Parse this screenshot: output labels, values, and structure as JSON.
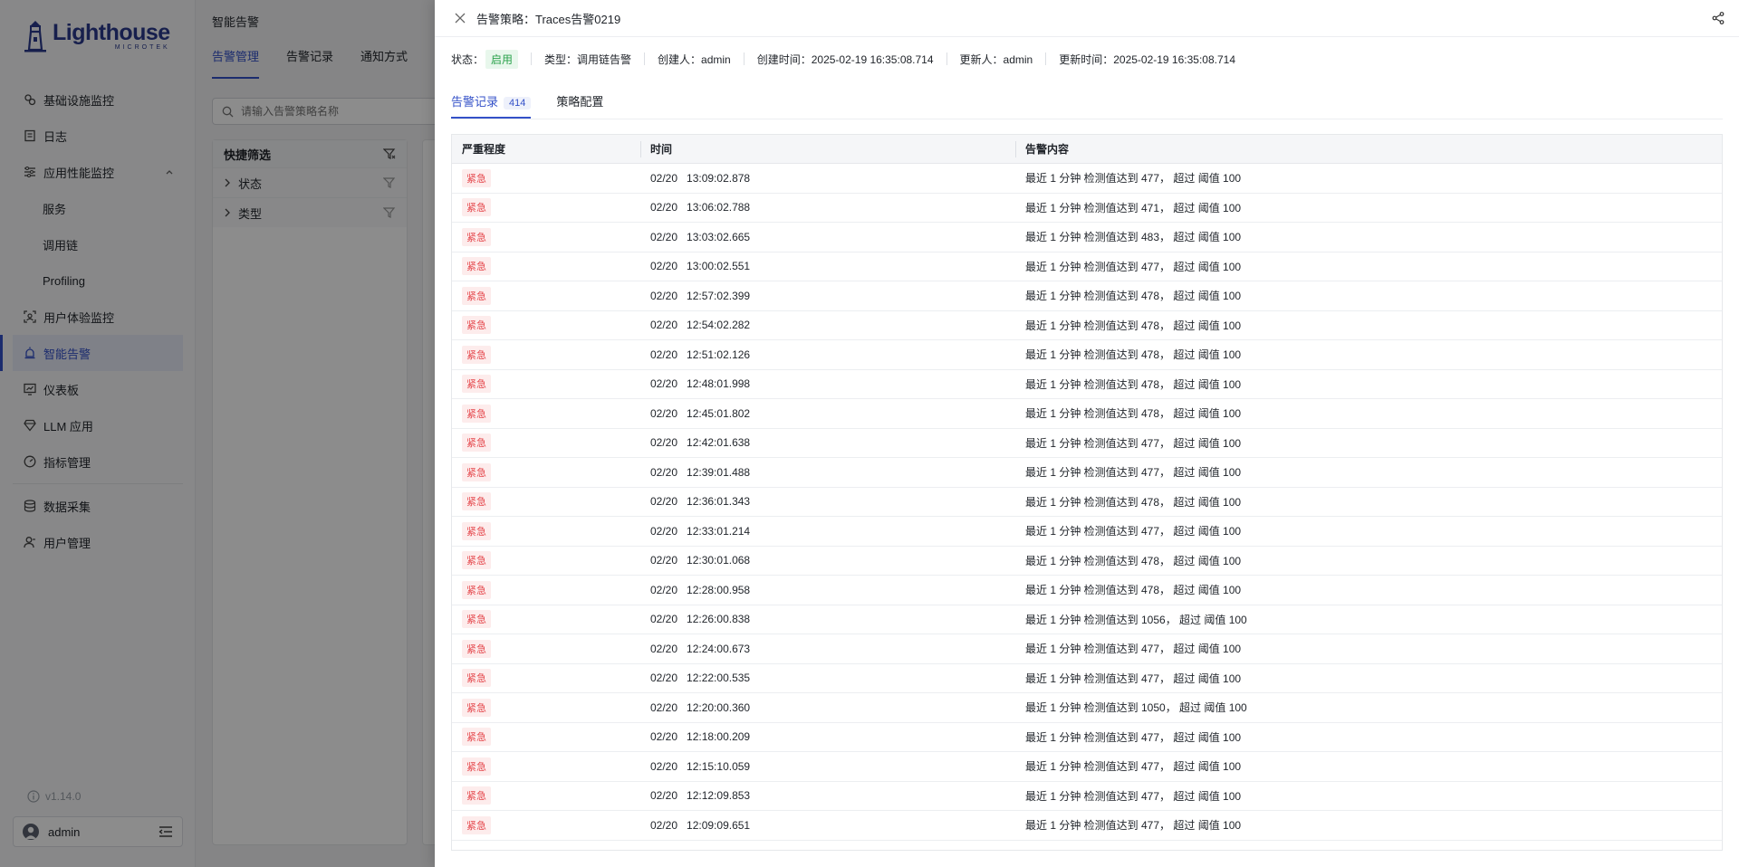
{
  "brand": {
    "name": "Lighthouse",
    "sub": "MICROTEK"
  },
  "sidebar": {
    "items": [
      {
        "label": "基础设施监控",
        "icon": "infra-icon"
      },
      {
        "label": "日志",
        "icon": "log-icon"
      },
      {
        "label": "应用性能监控",
        "icon": "apm-icon",
        "expanded": true,
        "children": [
          {
            "label": "服务"
          },
          {
            "label": "调用链"
          },
          {
            "label": "Profiling"
          }
        ]
      },
      {
        "label": "用户体验监控",
        "icon": "rum-icon"
      },
      {
        "label": "智能告警",
        "icon": "alert-icon",
        "active": true
      },
      {
        "label": "仪表板",
        "icon": "dashboard-icon"
      },
      {
        "label": "LLM 应用",
        "icon": "llm-icon"
      },
      {
        "label": "指标管理",
        "icon": "metric-icon"
      },
      {
        "label": "数据采集",
        "icon": "collect-icon"
      },
      {
        "label": "用户管理",
        "icon": "user-manage-icon"
      }
    ],
    "version": "v1.14.0",
    "user": "admin"
  },
  "main": {
    "title": "智能告警",
    "tabs": [
      "告警管理",
      "告警记录",
      "通知方式"
    ],
    "active_tab": 0,
    "search_placeholder": "请输入告警策略名称",
    "filter": {
      "title": "快捷筛选",
      "rows": [
        "状态",
        "类型"
      ]
    }
  },
  "drawer": {
    "title": "告警策略：Traces告警0219",
    "meta": {
      "status_label": "状态：",
      "status_value": "启用",
      "type": "类型：调用链告警",
      "creator": "创建人：admin",
      "created": "创建时间：2025-02-19 16:35:08.714",
      "updater": "更新人：admin",
      "updated": "更新时间：2025-02-19 16:35:08.714"
    },
    "tabs": [
      {
        "label": "告警记录",
        "count": "414"
      },
      {
        "label": "策略配置"
      }
    ],
    "columns": [
      "严重程度",
      "时间",
      "告警内容"
    ],
    "rows": [
      {
        "sev": "紧急",
        "date": "02/20",
        "time": "13:09:02.878",
        "content": "最近 1 分钟 检测值达到 477， 超过 阈值 100"
      },
      {
        "sev": "紧急",
        "date": "02/20",
        "time": "13:06:02.788",
        "content": "最近 1 分钟 检测值达到 471， 超过 阈值 100"
      },
      {
        "sev": "紧急",
        "date": "02/20",
        "time": "13:03:02.665",
        "content": "最近 1 分钟 检测值达到 483， 超过 阈值 100"
      },
      {
        "sev": "紧急",
        "date": "02/20",
        "time": "13:00:02.551",
        "content": "最近 1 分钟 检测值达到 477， 超过 阈值 100"
      },
      {
        "sev": "紧急",
        "date": "02/20",
        "time": "12:57:02.399",
        "content": "最近 1 分钟 检测值达到 478， 超过 阈值 100"
      },
      {
        "sev": "紧急",
        "date": "02/20",
        "time": "12:54:02.282",
        "content": "最近 1 分钟 检测值达到 478， 超过 阈值 100"
      },
      {
        "sev": "紧急",
        "date": "02/20",
        "time": "12:51:02.126",
        "content": "最近 1 分钟 检测值达到 478， 超过 阈值 100"
      },
      {
        "sev": "紧急",
        "date": "02/20",
        "time": "12:48:01.998",
        "content": "最近 1 分钟 检测值达到 478， 超过 阈值 100"
      },
      {
        "sev": "紧急",
        "date": "02/20",
        "time": "12:45:01.802",
        "content": "最近 1 分钟 检测值达到 478， 超过 阈值 100"
      },
      {
        "sev": "紧急",
        "date": "02/20",
        "time": "12:42:01.638",
        "content": "最近 1 分钟 检测值达到 477， 超过 阈值 100"
      },
      {
        "sev": "紧急",
        "date": "02/20",
        "time": "12:39:01.488",
        "content": "最近 1 分钟 检测值达到 477， 超过 阈值 100"
      },
      {
        "sev": "紧急",
        "date": "02/20",
        "time": "12:36:01.343",
        "content": "最近 1 分钟 检测值达到 478， 超过 阈值 100"
      },
      {
        "sev": "紧急",
        "date": "02/20",
        "time": "12:33:01.214",
        "content": "最近 1 分钟 检测值达到 477， 超过 阈值 100"
      },
      {
        "sev": "紧急",
        "date": "02/20",
        "time": "12:30:01.068",
        "content": "最近 1 分钟 检测值达到 478， 超过 阈值 100"
      },
      {
        "sev": "紧急",
        "date": "02/20",
        "time": "12:28:00.958",
        "content": "最近 1 分钟 检测值达到 478， 超过 阈值 100"
      },
      {
        "sev": "紧急",
        "date": "02/20",
        "time": "12:26:00.838",
        "content": "最近 1 分钟 检测值达到 1056， 超过 阈值 100"
      },
      {
        "sev": "紧急",
        "date": "02/20",
        "time": "12:24:00.673",
        "content": "最近 1 分钟 检测值达到 477， 超过 阈值 100"
      },
      {
        "sev": "紧急",
        "date": "02/20",
        "time": "12:22:00.535",
        "content": "最近 1 分钟 检测值达到 477， 超过 阈值 100"
      },
      {
        "sev": "紧急",
        "date": "02/20",
        "time": "12:20:00.360",
        "content": "最近 1 分钟 检测值达到 1050， 超过 阈值 100"
      },
      {
        "sev": "紧急",
        "date": "02/20",
        "time": "12:18:00.209",
        "content": "最近 1 分钟 检测值达到 477， 超过 阈值 100"
      },
      {
        "sev": "紧急",
        "date": "02/20",
        "time": "12:15:10.059",
        "content": "最近 1 分钟 检测值达到 477， 超过 阈值 100"
      },
      {
        "sev": "紧急",
        "date": "02/20",
        "time": "12:12:09.853",
        "content": "最近 1 分钟 检测值达到 477， 超过 阈值 100"
      },
      {
        "sev": "紧急",
        "date": "02/20",
        "time": "12:09:09.651",
        "content": "最近 1 分钟 检测值达到 477， 超过 阈值 100"
      }
    ]
  },
  "colors": {
    "accent": "#3451c8",
    "danger": "#e5484d",
    "success": "#2ba24c"
  }
}
